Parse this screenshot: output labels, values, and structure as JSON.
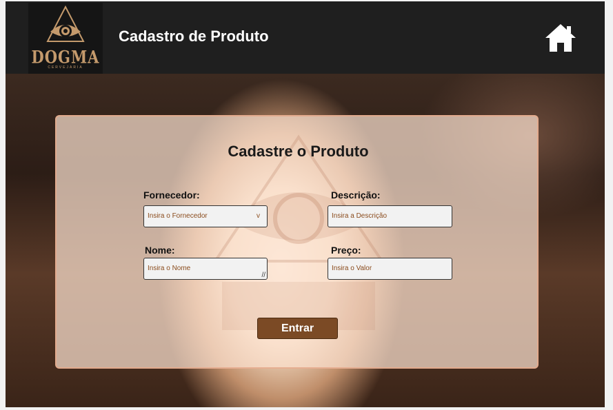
{
  "header": {
    "title": "Cadastro de Produto",
    "logo_word": "DOGMA",
    "logo_sub": "CERVEJARIA",
    "logo_icon": "eye-hop-triangle-icon",
    "home_icon": "home-icon"
  },
  "form": {
    "title": "Cadastre o Produto",
    "fornecedor": {
      "label": "Fornecedor:",
      "placeholder": "Insira o Fornecedor",
      "chevron": "v"
    },
    "descricao": {
      "label": "Descrição:",
      "placeholder": "Insira a Descrição"
    },
    "nome": {
      "label": "Nome:",
      "placeholder": "Insira o Nome"
    },
    "preco": {
      "label": "Preço:",
      "placeholder": "Insira o Valor"
    },
    "submit_label": "Entrar"
  },
  "colors": {
    "header_bg": "#1f1f1f",
    "accent_brown": "#7b4a25",
    "logo_gold": "#c49a6c",
    "placeholder_text": "#8a4b1c"
  }
}
